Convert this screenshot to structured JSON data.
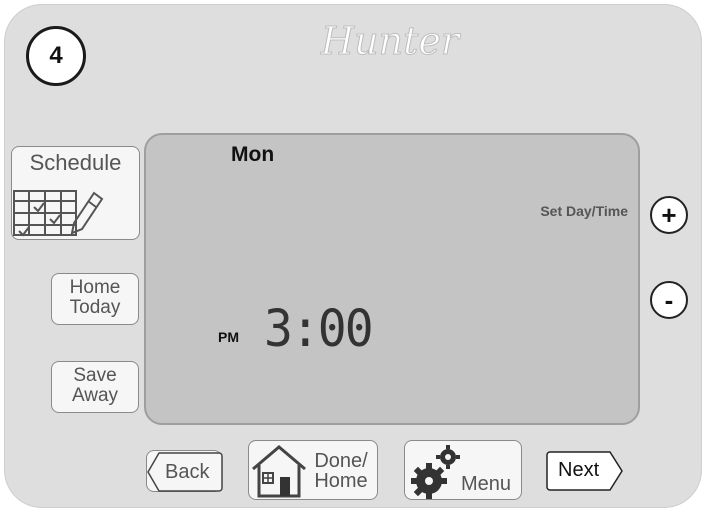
{
  "step": {
    "number": "4"
  },
  "brand": {
    "name": "Hunter"
  },
  "display": {
    "day": "Mon",
    "mode_label": "Set Day/Time",
    "ampm": "PM",
    "time": "3:00"
  },
  "side_buttons": {
    "schedule": "Schedule",
    "home_today_line1": "Home",
    "home_today_line2": "Today",
    "save_away_line1": "Save",
    "save_away_line2": "Away"
  },
  "adjust": {
    "plus": "+",
    "minus": "-"
  },
  "bottom_buttons": {
    "back": "Back",
    "done_line1": "Done/",
    "done_line2": "Home",
    "menu": "Menu",
    "next": "Next"
  },
  "colors": {
    "body": "#dedede",
    "screen": "#c4c4c4",
    "button": "#f6f6f6",
    "text": "#555555"
  }
}
